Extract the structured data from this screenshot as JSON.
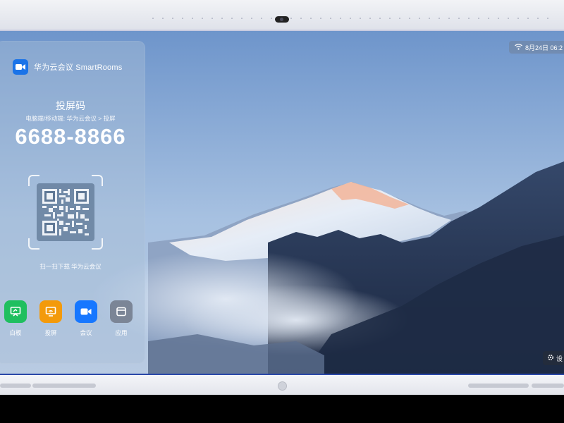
{
  "brand": {
    "name": "华为云会议 SmartRooms",
    "icon": "video-camera-icon",
    "color": "#1a73e8"
  },
  "cast": {
    "title": "投屏码",
    "instruction": "电脑端/移动端: 华为云会议 > 投屏",
    "code": "6688-8866",
    "qr_caption": "扫一扫下载 华为云会议"
  },
  "apps": [
    {
      "label": "白板",
      "icon": "whiteboard-icon",
      "color": "#1fbf5f"
    },
    {
      "label": "投屏",
      "icon": "screen-cast-icon",
      "color": "#f39a0b"
    },
    {
      "label": "会议",
      "icon": "video-camera-icon",
      "color": "#1677ff"
    },
    {
      "label": "应用",
      "icon": "apps-icon",
      "color": "#7b8596"
    }
  ],
  "status": {
    "date_time": "8月24日 06:2",
    "wifi": "wifi-icon"
  },
  "settings": {
    "label": "设",
    "icon": "gear-icon"
  }
}
